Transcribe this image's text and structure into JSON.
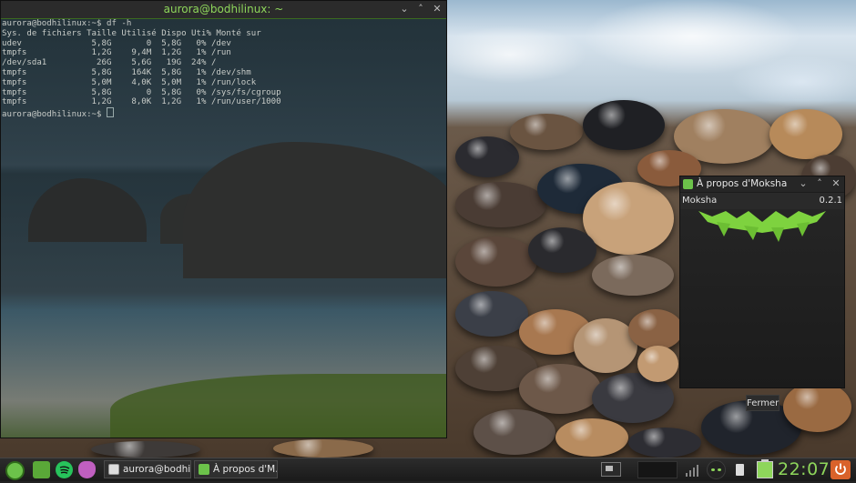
{
  "terminal": {
    "title": "aurora@bodhilinux: ~",
    "buttons": {
      "minimize": "⌄",
      "maximize": "˄",
      "close": "✕"
    },
    "lines": [
      "aurora@bodhilinux:~$ df -h",
      "Sys. de fichiers Taille Utilisé Dispo Uti% Monté sur",
      "udev              5,8G       0  5,8G   0% /dev",
      "tmpfs             1,2G    9,4M  1,2G   1% /run",
      "/dev/sda1          26G    5,6G   19G  24% /",
      "tmpfs             5,8G    164K  5,8G   1% /dev/shm",
      "tmpfs             5,0M    4,0K  5,0M   1% /run/lock",
      "tmpfs             5,8G       0  5,8G   0% /sys/fs/cgroup",
      "tmpfs             1,2G    8,0K  1,2G   1% /run/user/1000",
      "aurora@bodhilinux:~$ "
    ]
  },
  "about": {
    "title": "À propos d'Moksha",
    "buttons": {
      "minimize": "⌄",
      "maximize": "˄",
      "close": "✕"
    },
    "app_name": "Moksha",
    "version": "0.2.1",
    "close_label": "Fermer"
  },
  "taskbar": {
    "tasks": [
      {
        "label": "aurora@bodhi…"
      },
      {
        "label": "À propos d'M…"
      }
    ],
    "clock": "22:07",
    "colors": {
      "accent": "#8ed65b",
      "power": "#d9622b"
    }
  }
}
